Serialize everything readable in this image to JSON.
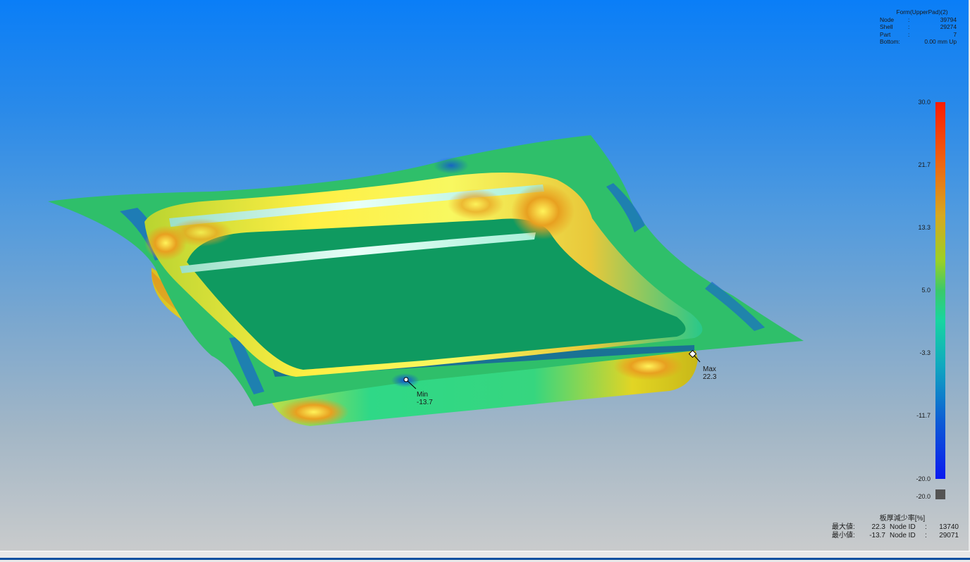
{
  "model_info": {
    "title": "Form(UpperPad)(2)",
    "rows": [
      {
        "key": "Node",
        "colon": ":",
        "value": "39794"
      },
      {
        "key": "Shell",
        "colon": ":",
        "value": "29274"
      },
      {
        "key": "Part",
        "colon": ":",
        "value": "7"
      },
      {
        "key": "Bottom:",
        "colon": "",
        "value": "0.00 mm Up"
      }
    ]
  },
  "legend": {
    "ticks": [
      "30.0",
      "21.7",
      "13.3",
      "5.0",
      "-3.3",
      "-11.7",
      "-20.0"
    ],
    "under_value": "-20.0",
    "colors": {
      "max": "#ff1a00",
      "mid": "#3ac96a",
      "min": "#0a1af0",
      "under": "#545454"
    }
  },
  "result": {
    "title": "板厚減少率[%]",
    "max_label": "最大値:",
    "max_value": "22.3",
    "min_label": "最小値:",
    "min_value": "-13.7",
    "node_id_label": "Node ID",
    "id_colon": ":",
    "max_node_id": "13740",
    "min_node_id": "29071"
  },
  "markers": {
    "max": {
      "label": "Max",
      "value": "22.3"
    },
    "min": {
      "label": "Min",
      "value": "-13.7"
    }
  }
}
